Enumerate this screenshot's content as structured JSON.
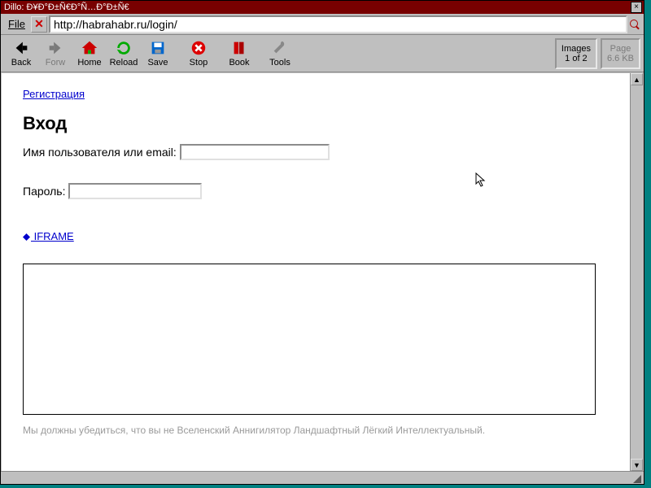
{
  "title": "Dillo: Ð¥Ð°Ð±Ñ€Ð°Ñ…Ð°Ð±Ñ€",
  "menubar": {
    "file": "File"
  },
  "url": "http://habrahabr.ru/login/",
  "toolbar": {
    "back": "Back",
    "forw": "Forw",
    "home": "Home",
    "reload": "Reload",
    "save": "Save",
    "stop": "Stop",
    "book": "Book",
    "tools": "Tools"
  },
  "info": {
    "images_l1": "Images",
    "images_l2": "1 of 2",
    "page_l1": "Page",
    "page_l2": "6.6 KB"
  },
  "page": {
    "register_link": "Регистрация",
    "heading": "Вход",
    "username_label": "Имя пользователя или email:",
    "password_label": "Пароль:",
    "iframe_link": " IFRAME",
    "caption": "Мы должны убедиться, что вы не Вселенский Аннигилятор Ландшафтный Лёгкий Интеллектуальный."
  }
}
